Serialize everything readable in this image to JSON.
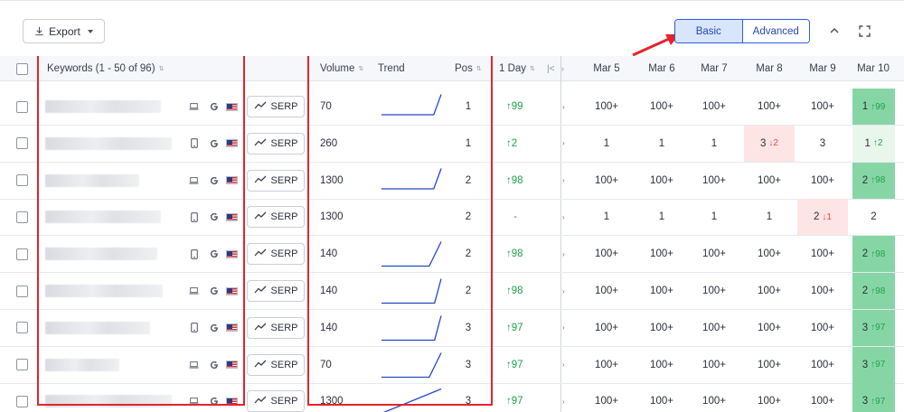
{
  "toolbar": {
    "export_label": "Export",
    "view_modes": [
      {
        "label": "Basic",
        "active": true
      },
      {
        "label": "Advanced",
        "active": false
      }
    ],
    "collapse_icon": "chevron-up-icon",
    "expand_icon": "fullscreen-icon"
  },
  "table": {
    "headers": {
      "keywords": "Keywords (1 - 50 of 96)",
      "volume": "Volume",
      "trend": "Trend",
      "pos": "Pos",
      "one_day": "1 Day",
      "dates": [
        "Mar 5",
        "Mar 6",
        "Mar 7",
        "Mar 8",
        "Mar 9",
        "Mar 10"
      ]
    },
    "serp_label": "SERP",
    "rows": [
      {
        "device": "desktop",
        "volume": "70",
        "pos": "1",
        "day": "99",
        "day_dir": "up",
        "trend": [
          0.2,
          0.2,
          0.2,
          0.2,
          0.2,
          0.2,
          0.2,
          0.2,
          0.95
        ],
        "d": [
          "100+",
          "100+",
          "100+",
          "100+",
          "100+"
        ],
        "last": {
          "pos": "1",
          "delta": "99",
          "bg": "green"
        }
      },
      {
        "device": "mobile",
        "volume": "260",
        "pos": "1",
        "day": "2",
        "day_dir": "up",
        "trend": null,
        "d": [
          "1",
          "1",
          "1",
          "3|2|down|red",
          "3"
        ],
        "last": {
          "pos": "1",
          "delta": "2",
          "bg": "lightgreen"
        }
      },
      {
        "device": "desktop",
        "volume": "1300",
        "pos": "2",
        "day": "98",
        "day_dir": "up",
        "trend": [
          0.2,
          0.2,
          0.2,
          0.2,
          0.2,
          0.2,
          0.2,
          0.2,
          0.95
        ],
        "d": [
          "100+",
          "100+",
          "100+",
          "100+",
          "100+"
        ],
        "last": {
          "pos": "2",
          "delta": "98",
          "bg": "green"
        }
      },
      {
        "device": "mobile",
        "volume": "1300",
        "pos": "2",
        "day": "-",
        "day_dir": "none",
        "trend": null,
        "d": [
          "1",
          "1",
          "1",
          "1",
          "2|1|down|red"
        ],
        "last": {
          "pos": "2",
          "delta": "",
          "bg": "none"
        }
      },
      {
        "device": "mobile",
        "volume": "140",
        "pos": "2",
        "day": "98",
        "day_dir": "up",
        "trend": [
          0.05,
          0.05,
          0.05,
          0.05,
          0.05,
          0.95
        ],
        "d": [
          "100+",
          "100+",
          "100+",
          "100+",
          "100+"
        ],
        "last": {
          "pos": "2",
          "delta": "98",
          "bg": "green"
        }
      },
      {
        "device": "desktop",
        "volume": "140",
        "pos": "2",
        "day": "98",
        "day_dir": "up",
        "trend": [
          0.05,
          0.05,
          0.05,
          0.05,
          0.05,
          0.05,
          0.05,
          0.05,
          0.05,
          0.95
        ],
        "d": [
          "100+",
          "100+",
          "100+",
          "100+",
          "100+"
        ],
        "last": {
          "pos": "2",
          "delta": "98",
          "bg": "green"
        }
      },
      {
        "device": "mobile",
        "volume": "140",
        "pos": "3",
        "day": "97",
        "day_dir": "up",
        "trend": [
          0.05,
          0.05,
          0.05,
          0.05,
          0.05,
          0.05,
          0.05,
          0.05,
          0.05,
          0.95
        ],
        "d": [
          "100+",
          "100+",
          "100+",
          "100+",
          "100+"
        ],
        "last": {
          "pos": "3",
          "delta": "97",
          "bg": "green"
        }
      },
      {
        "device": "desktop",
        "volume": "70",
        "pos": "3",
        "day": "97",
        "day_dir": "up",
        "trend": [
          0.05,
          0.05,
          0.05,
          0.05,
          0.05,
          0.95
        ],
        "d": [
          "100+",
          "100+",
          "100+",
          "100+",
          "100+"
        ],
        "last": {
          "pos": "3",
          "delta": "97",
          "bg": "green"
        }
      },
      {
        "device": "desktop",
        "volume": "1300",
        "pos": "3",
        "day": "97",
        "day_dir": "up",
        "trend": [
          0.05,
          0.95
        ],
        "d": [
          "100+",
          "100+",
          "100+",
          "100+",
          "100+"
        ],
        "last": {
          "pos": "3",
          "delta": "97",
          "bg": "green"
        }
      }
    ]
  },
  "colors": {
    "accent": "#2c5be6",
    "highlight": "#e3242b",
    "up": "#1fa14a",
    "down": "#e04848",
    "trend_line": "#2347c8"
  }
}
